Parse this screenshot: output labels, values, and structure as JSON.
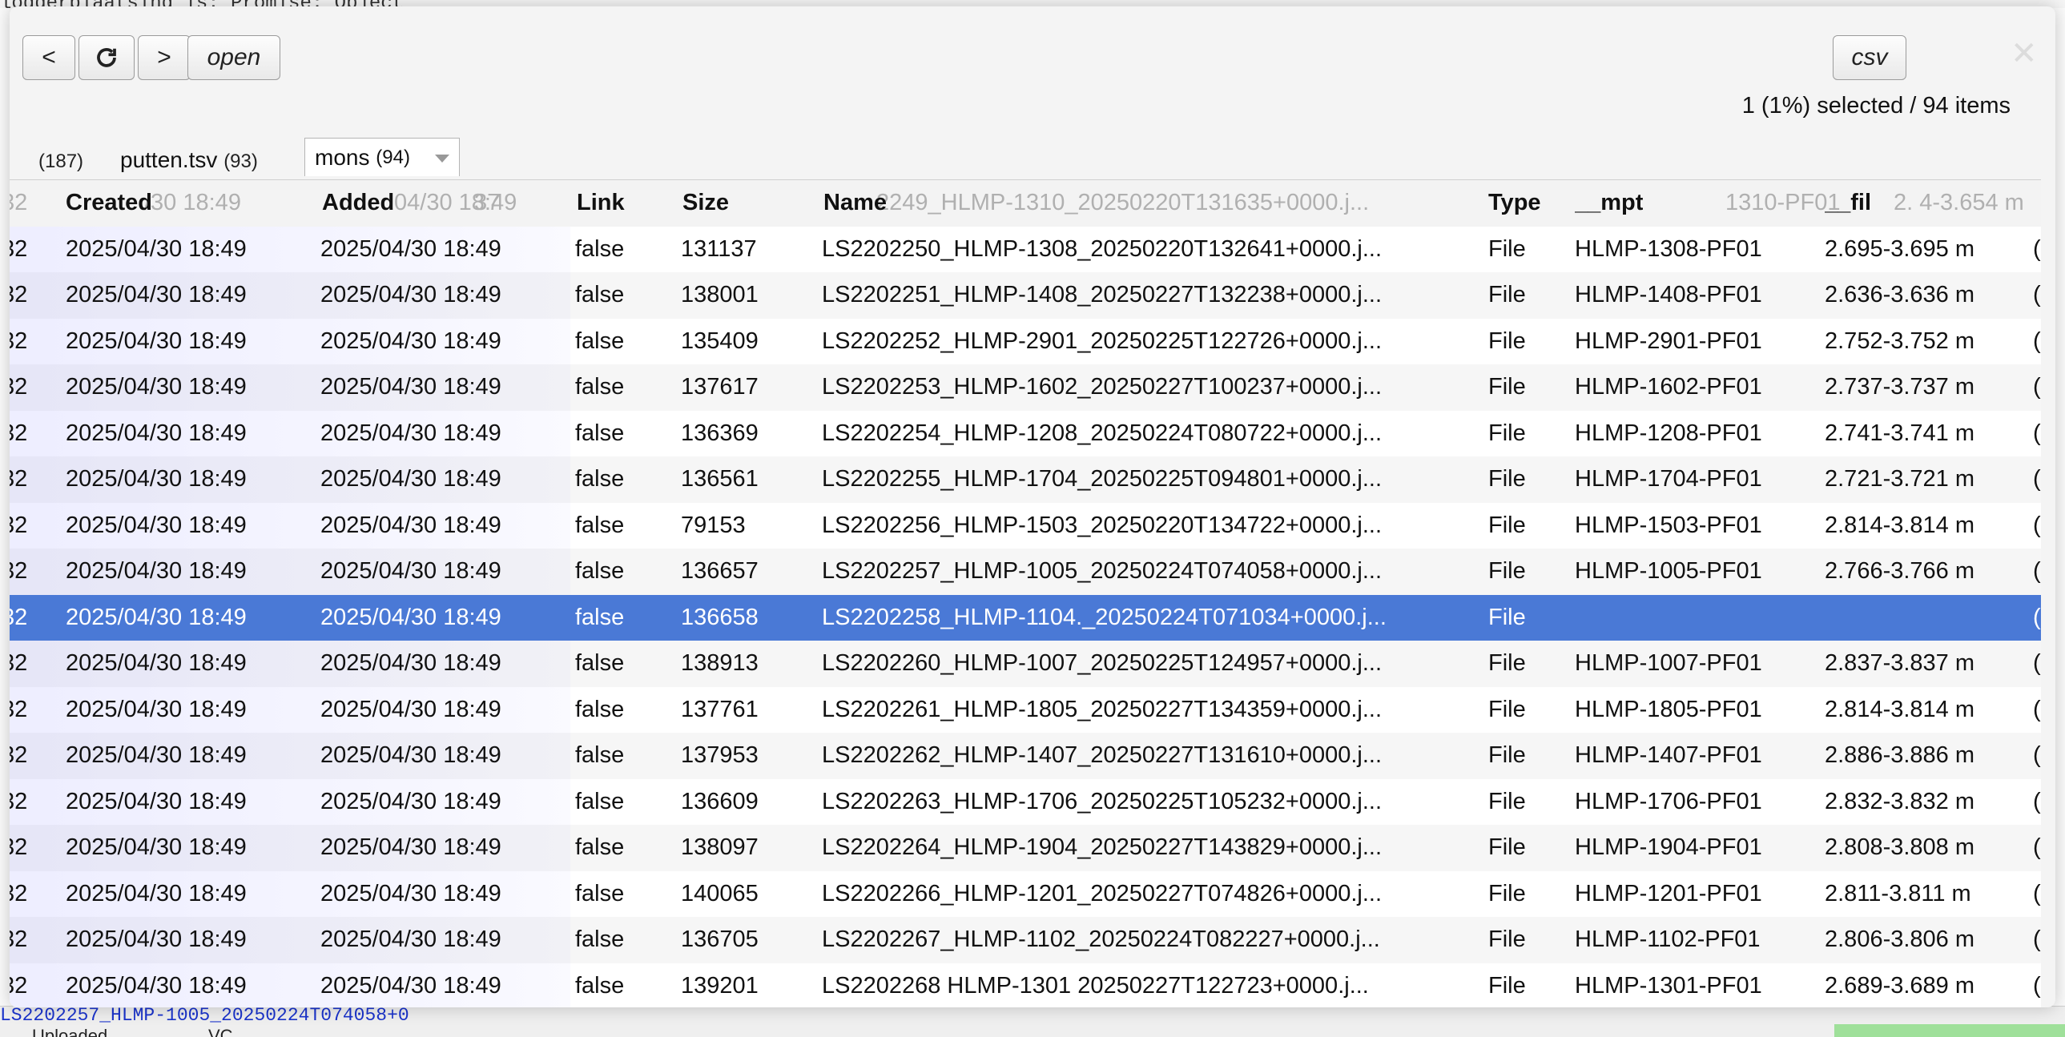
{
  "background": {
    "top_code_text": "loggerplaatsing is: Promise: Object",
    "bottom_path_text": "LS2202257_HLMP-1005_20250224T074058+0",
    "bottom_tabs": [
      "Uploaded",
      "VC"
    ]
  },
  "toolbar": {
    "prev_label": "<",
    "refresh_icon": "refresh-icon",
    "next_label": ">",
    "open_label": "open",
    "csv_label": "csv",
    "close_icon": "close-icon"
  },
  "status": "1 (1%) selected / 94 items",
  "tabs": [
    {
      "label": "",
      "count": "(187)"
    },
    {
      "label": "putten.tsv",
      "count": "(93)"
    },
    {
      "label": "mons",
      "count": "(94)",
      "active": true
    }
  ],
  "table": {
    "columns": [
      "Created",
      "Added",
      "Link",
      "Size",
      "Name",
      "Type",
      "__mpt",
      "__fil"
    ],
    "header_ghost": {
      "lead": "32",
      "created": "/30 18:49",
      "added": "04/30 18:49",
      "size": "37",
      "name": "2249_HLMP-1310_20250220T131635+0000.j...",
      "mpt": "1310-PF01",
      "fil": "2.  4-3.654 m"
    },
    "rows": [
      {
        "lead": "32",
        "created": "2025/04/30 18:49",
        "added": "2025/04/30 18:49",
        "link": "false",
        "size": "131137",
        "name": "LS2202250_HLMP-1308_20250220T132641+0000.j...",
        "type": "File",
        "mpt": "HLMP-1308-PF01",
        "fil": "2.695-3.695 m",
        "tail": "("
      },
      {
        "lead": "32",
        "created": "2025/04/30 18:49",
        "added": "2025/04/30 18:49",
        "link": "false",
        "size": "138001",
        "name": "LS2202251_HLMP-1408_20250227T132238+0000.j...",
        "type": "File",
        "mpt": "HLMP-1408-PF01",
        "fil": "2.636-3.636 m",
        "tail": "("
      },
      {
        "lead": "32",
        "created": "2025/04/30 18:49",
        "added": "2025/04/30 18:49",
        "link": "false",
        "size": "135409",
        "name": "LS2202252_HLMP-2901_20250225T122726+0000.j...",
        "type": "File",
        "mpt": "HLMP-2901-PF01",
        "fil": "2.752-3.752 m",
        "tail": "("
      },
      {
        "lead": "32",
        "created": "2025/04/30 18:49",
        "added": "2025/04/30 18:49",
        "link": "false",
        "size": "137617",
        "name": "LS2202253_HLMP-1602_20250227T100237+0000.j...",
        "type": "File",
        "mpt": "HLMP-1602-PF01",
        "fil": "2.737-3.737 m",
        "tail": "("
      },
      {
        "lead": "32",
        "created": "2025/04/30 18:49",
        "added": "2025/04/30 18:49",
        "link": "false",
        "size": "136369",
        "name": "LS2202254_HLMP-1208_20250224T080722+0000.j...",
        "type": "File",
        "mpt": "HLMP-1208-PF01",
        "fil": "2.741-3.741 m",
        "tail": "("
      },
      {
        "lead": "32",
        "created": "2025/04/30 18:49",
        "added": "2025/04/30 18:49",
        "link": "false",
        "size": "136561",
        "name": "LS2202255_HLMP-1704_20250225T094801+0000.j...",
        "type": "File",
        "mpt": "HLMP-1704-PF01",
        "fil": "2.721-3.721 m",
        "tail": "("
      },
      {
        "lead": "32",
        "created": "2025/04/30 18:49",
        "added": "2025/04/30 18:49",
        "link": "false",
        "size": "79153",
        "name": "LS2202256_HLMP-1503_20250220T134722+0000.j...",
        "type": "File",
        "mpt": "HLMP-1503-PF01",
        "fil": "2.814-3.814 m",
        "tail": "("
      },
      {
        "lead": "32",
        "created": "2025/04/30 18:49",
        "added": "2025/04/30 18:49",
        "link": "false",
        "size": "136657",
        "name": "LS2202257_HLMP-1005_20250224T074058+0000.j...",
        "type": "File",
        "mpt": "HLMP-1005-PF01",
        "fil": "2.766-3.766 m",
        "tail": "("
      },
      {
        "lead": "32",
        "created": "2025/04/30 18:49",
        "added": "2025/04/30 18:49",
        "link": "false",
        "size": "136658",
        "name": "LS2202258_HLMP-1104._20250224T071034+0000.j...",
        "type": "File",
        "mpt": "",
        "fil": "",
        "tail": "(",
        "selected": true
      },
      {
        "lead": "32",
        "created": "2025/04/30 18:49",
        "added": "2025/04/30 18:49",
        "link": "false",
        "size": "138913",
        "name": "LS2202260_HLMP-1007_20250225T124957+0000.j...",
        "type": "File",
        "mpt": "HLMP-1007-PF01",
        "fil": "2.837-3.837 m",
        "tail": "("
      },
      {
        "lead": "32",
        "created": "2025/04/30 18:49",
        "added": "2025/04/30 18:49",
        "link": "false",
        "size": "137761",
        "name": "LS2202261_HLMP-1805_20250227T134359+0000.j...",
        "type": "File",
        "mpt": "HLMP-1805-PF01",
        "fil": "2.814-3.814 m",
        "tail": "("
      },
      {
        "lead": "32",
        "created": "2025/04/30 18:49",
        "added": "2025/04/30 18:49",
        "link": "false",
        "size": "137953",
        "name": "LS2202262_HLMP-1407_20250227T131610+0000.j...",
        "type": "File",
        "mpt": "HLMP-1407-PF01",
        "fil": "2.886-3.886 m",
        "tail": "("
      },
      {
        "lead": "32",
        "created": "2025/04/30 18:49",
        "added": "2025/04/30 18:49",
        "link": "false",
        "size": "136609",
        "name": "LS2202263_HLMP-1706_20250225T105232+0000.j...",
        "type": "File",
        "mpt": "HLMP-1706-PF01",
        "fil": "2.832-3.832 m",
        "tail": "("
      },
      {
        "lead": "32",
        "created": "2025/04/30 18:49",
        "added": "2025/04/30 18:49",
        "link": "false",
        "size": "138097",
        "name": "LS2202264_HLMP-1904_20250227T143829+0000.j...",
        "type": "File",
        "mpt": "HLMP-1904-PF01",
        "fil": "2.808-3.808 m",
        "tail": "("
      },
      {
        "lead": "32",
        "created": "2025/04/30 18:49",
        "added": "2025/04/30 18:49",
        "link": "false",
        "size": "140065",
        "name": "LS2202266_HLMP-1201_20250227T074826+0000.j...",
        "type": "File",
        "mpt": "HLMP-1201-PF01",
        "fil": "2.811-3.811 m",
        "tail": "("
      },
      {
        "lead": "32",
        "created": "2025/04/30 18:49",
        "added": "2025/04/30 18:49",
        "link": "false",
        "size": "136705",
        "name": "LS2202267_HLMP-1102_20250224T082227+0000.j...",
        "type": "File",
        "mpt": "HLMP-1102-PF01",
        "fil": "2.806-3.806 m",
        "tail": "("
      },
      {
        "lead": "32",
        "created": "2025/04/30 18:49",
        "added": "2025/04/30 18:49",
        "link": "false",
        "size": "139201",
        "name": "LS2202268 HLMP-1301 20250227T122723+0000.j...",
        "type": "File",
        "mpt": "HLMP-1301-PF01",
        "fil": "2.689-3.689 m",
        "tail": "("
      }
    ]
  },
  "colors": {
    "selection": "#4a79d6",
    "link_blue": "#1a33cc"
  }
}
